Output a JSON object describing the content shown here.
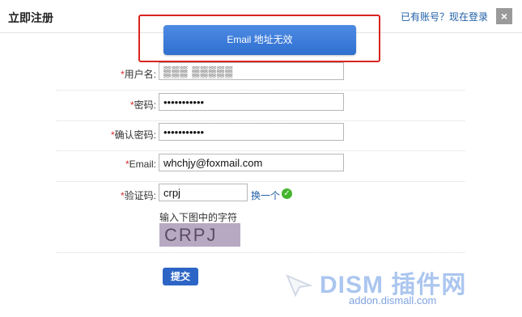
{
  "header": {
    "title": "立即注册",
    "login_link": "已有账号？现在登录",
    "close": "×"
  },
  "alert": {
    "message": "Email 地址无效"
  },
  "form": {
    "username": {
      "label": "用户名:",
      "value": "▒▒▒ ▒▒▒▒▒"
    },
    "password": {
      "label": "密码:",
      "value": "•••••••••••"
    },
    "confirm_password": {
      "label": "确认密码:",
      "value": "•••••••••••"
    },
    "email": {
      "label": "Email:",
      "value": "whchjy@foxmail.com"
    },
    "captcha": {
      "label": "验证码:",
      "value": "crpj",
      "change_link": "换一个",
      "hint": "输入下图中的字符",
      "image_text": "CRPJ"
    },
    "required_mark": "*",
    "submit": "提交"
  },
  "watermark": {
    "brand": "DISM 插件网",
    "domain": "addon.dismall.com"
  }
}
